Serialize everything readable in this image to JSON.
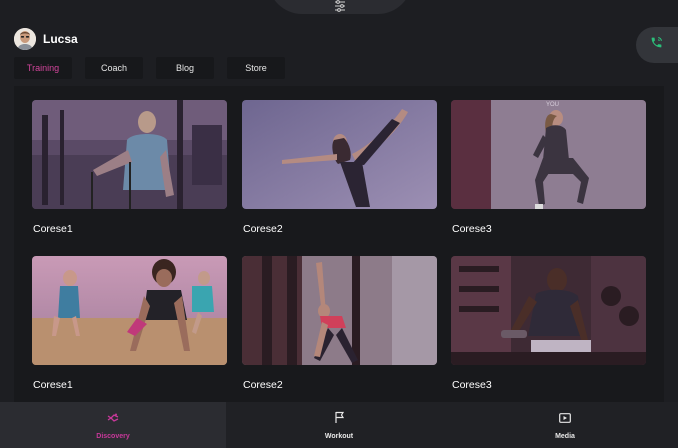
{
  "app": {
    "user": {
      "name": "Lucsa"
    },
    "icons": {
      "top_handle": "sliders-icon",
      "call": "phone-icon"
    },
    "colors": {
      "accent": "#d2459b",
      "call_icon": "#2bbf7a",
      "background": "#1d1e22"
    }
  },
  "tabs": [
    {
      "label": "Training",
      "active": true
    },
    {
      "label": "Coach",
      "active": false
    },
    {
      "label": "Blog",
      "active": false
    },
    {
      "label": "Store",
      "active": false
    }
  ],
  "cards": [
    {
      "title": "Corese1",
      "image": "man-cable-machine-gym"
    },
    {
      "title": "Corese2",
      "image": "woman-yoga-dancer-pose"
    },
    {
      "title": "Corese3",
      "image": "woman-squat-wall"
    },
    {
      "title": "Corese1",
      "image": "group-pushups"
    },
    {
      "title": "Corese2",
      "image": "woman-triangle-stretch"
    },
    {
      "title": "Corese3",
      "image": "man-dumbbell-row"
    }
  ],
  "bottom_nav": [
    {
      "label": "Discovery",
      "icon": "discovery-icon",
      "active": true
    },
    {
      "label": "Workout",
      "icon": "flag-icon",
      "active": false
    },
    {
      "label": "Media",
      "icon": "media-icon",
      "active": false
    }
  ]
}
